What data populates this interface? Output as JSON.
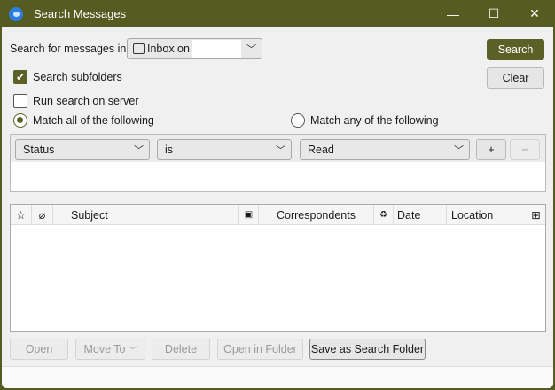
{
  "window": {
    "title": "Search Messages",
    "minimize": "—",
    "maximize": "☐",
    "close": "✕"
  },
  "search_in": {
    "label": "Search for messages in:",
    "value": "Inbox on"
  },
  "buttons": {
    "search": "Search",
    "clear": "Clear"
  },
  "options": {
    "search_subfolders": "Search subfolders",
    "search_subfolders_checked": true,
    "run_on_server": "Run search on server",
    "run_on_server_checked": false,
    "match_all": "Match all of the following",
    "match_any": "Match any of the following",
    "selected_match": "all"
  },
  "rule": {
    "field": "Status",
    "operator": "is",
    "value": "Read",
    "add": "+",
    "remove": "−"
  },
  "columns": [
    "Subject",
    "Correspondents",
    "Date",
    "Location"
  ],
  "actions": {
    "open": "Open",
    "move_to": "Move To",
    "delete": "Delete",
    "open_in_folder": "Open in Folder",
    "save_as_search_folder": "Save as Search Folder"
  }
}
